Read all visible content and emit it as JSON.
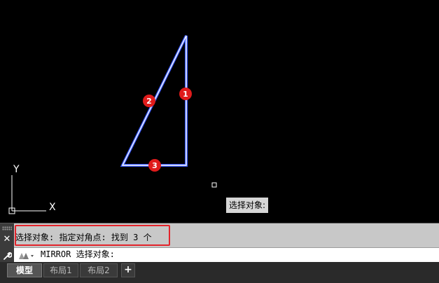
{
  "drawing": {
    "background_color": "#000000",
    "triangle_color": "#3b5bff",
    "triangle_outline_color": "#ffffff",
    "markers": [
      {
        "label": "1"
      },
      {
        "label": "2"
      },
      {
        "label": "3"
      }
    ],
    "marker_color": "#e01b1b",
    "ucs": {
      "x_label": "X",
      "y_label": "Y"
    }
  },
  "tooltip": {
    "text": "选择对象:"
  },
  "command_line": {
    "history": "选择对象: 指定对角点: 找到 3 个",
    "input_text": "MIRROR 选择对象:",
    "highlight_color": "#e3242b"
  },
  "layout_tabs": {
    "tabs": [
      {
        "label": "模型",
        "active": true
      },
      {
        "label": "布局1",
        "active": false
      },
      {
        "label": "布局2",
        "active": false
      }
    ],
    "add_label": "+"
  }
}
